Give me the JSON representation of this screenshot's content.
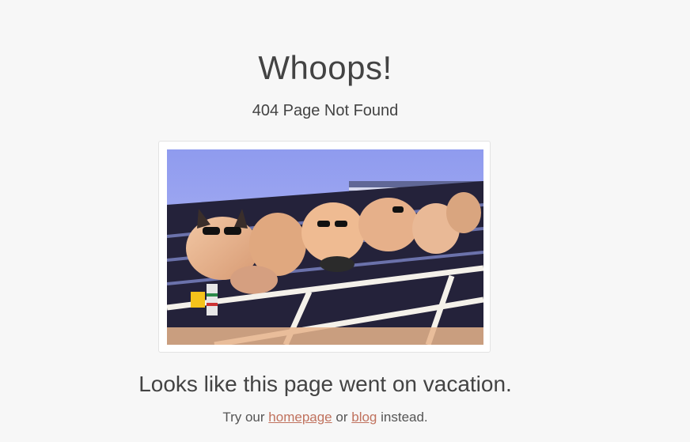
{
  "header": {
    "title": "Whoops!",
    "subtitle": "404 Page Not Found"
  },
  "image": {
    "description_icon": "vacation-dogs-gif"
  },
  "message": {
    "tagline": "Looks like this page went on vacation.",
    "hint_prefix": "Try our",
    "homepage_link": "homepage",
    "hint_middle": "or",
    "blog_link": "blog",
    "hint_suffix": "instead."
  },
  "colors": {
    "background": "#f7f7f7",
    "text": "#434343",
    "link": "#c0725e"
  }
}
